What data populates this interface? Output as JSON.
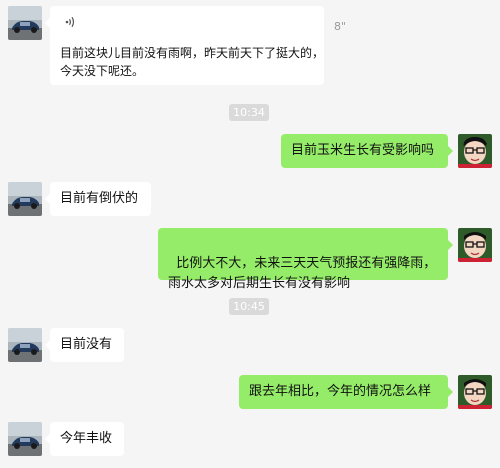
{
  "messages": [
    {
      "side": "left",
      "type": "voice",
      "duration": "8\"",
      "text": "目前这块儿目前没有雨啊，昨天前天下了挺大的，\n今天没下呢还。"
    },
    {
      "type": "time",
      "text": "10:34"
    },
    {
      "side": "right",
      "text": "目前玉米生长有受影响吗"
    },
    {
      "side": "left",
      "text": "目前有倒伏的"
    },
    {
      "side": "right",
      "text": "比例大不大，未来三天天气预报还有强降雨，\n雨水太多对后期生长有没有影响"
    },
    {
      "type": "time",
      "text": "10:45"
    },
    {
      "side": "left",
      "text": "目前没有"
    },
    {
      "side": "right",
      "text": "跟去年相比，今年的情况怎么样"
    },
    {
      "side": "left",
      "text": "今年丰收"
    }
  ],
  "icons": {
    "voice": "voice-wave-icon",
    "contact_avatar": "car-photo-avatar",
    "self_avatar": "cartoon-glasses-avatar"
  },
  "colors": {
    "background": "#f5f5f5",
    "incoming_bubble": "#ffffff",
    "outgoing_bubble": "#95ec69",
    "time_badge": "#dadada"
  }
}
